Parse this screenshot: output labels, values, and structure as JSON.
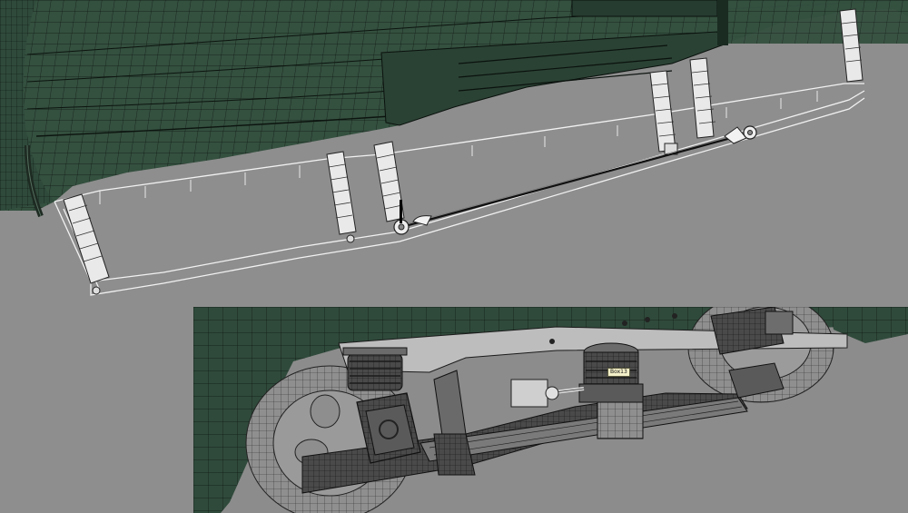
{
  "viewports": {
    "top": {
      "label": ""
    },
    "bottom": {
      "label": ""
    }
  },
  "object_tooltip": {
    "text": "Box13"
  },
  "colors": {
    "background": "#8e8e8e",
    "body_mesh": "#2f4a3c",
    "body_mesh_light": "#44604f",
    "wire": "#0d1510",
    "frame_white": "#f2f2f2",
    "bogie_dark": "#3a3a3a",
    "tooltip_bg": "#f3efc8"
  },
  "icons": {
    "pivot_gizmo": "pivot-icon"
  }
}
